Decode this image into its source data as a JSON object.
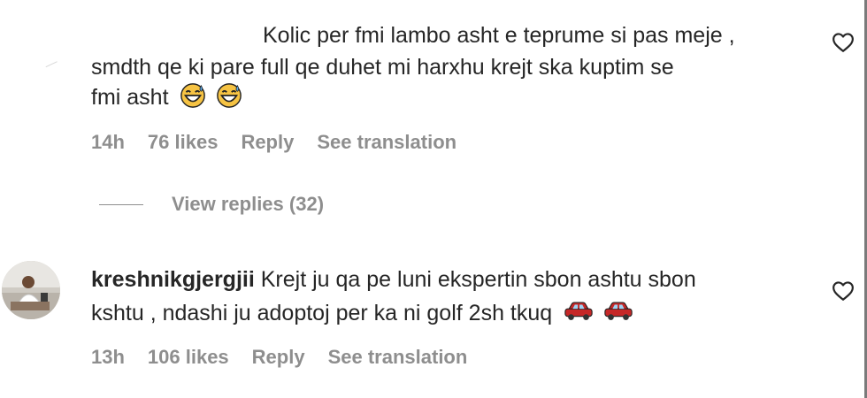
{
  "comment1": {
    "text_line1": "Kolic per fmi lambo asht e teprume si pas meje ,",
    "text_line2": "smdth qe ki pare full qe duhet mi harxhu krejt ska kuptim se",
    "text_line3": "fmi asht",
    "emojis": [
      "grinning-sweat-emoji",
      "grinning-sweat-emoji"
    ],
    "time": "14h",
    "likes": "76 likes",
    "reply": "Reply",
    "translation": "See translation",
    "heart_icon": "heart-outline-icon"
  },
  "view_replies": {
    "label": "View replies (32)"
  },
  "comment2": {
    "username": "kreshnikgjergjii",
    "text_line1": "Krejt ju qa pe luni ekspertin sbon ashtu sbon",
    "text_line2": "kshtu , ndashi ju adoptoj per ka ni golf 2sh tkuq",
    "emojis": [
      "red-car-emoji",
      "red-car-emoji"
    ],
    "time": "13h",
    "likes": "106 likes",
    "reply": "Reply",
    "translation": "See translation",
    "heart_icon": "heart-outline-icon"
  },
  "colors": {
    "text": "#262626",
    "meta": "#8e8e8e",
    "emoji_face": "#f6c343",
    "emoji_sweat": "#5aa9e6",
    "car_red": "#c62828"
  }
}
